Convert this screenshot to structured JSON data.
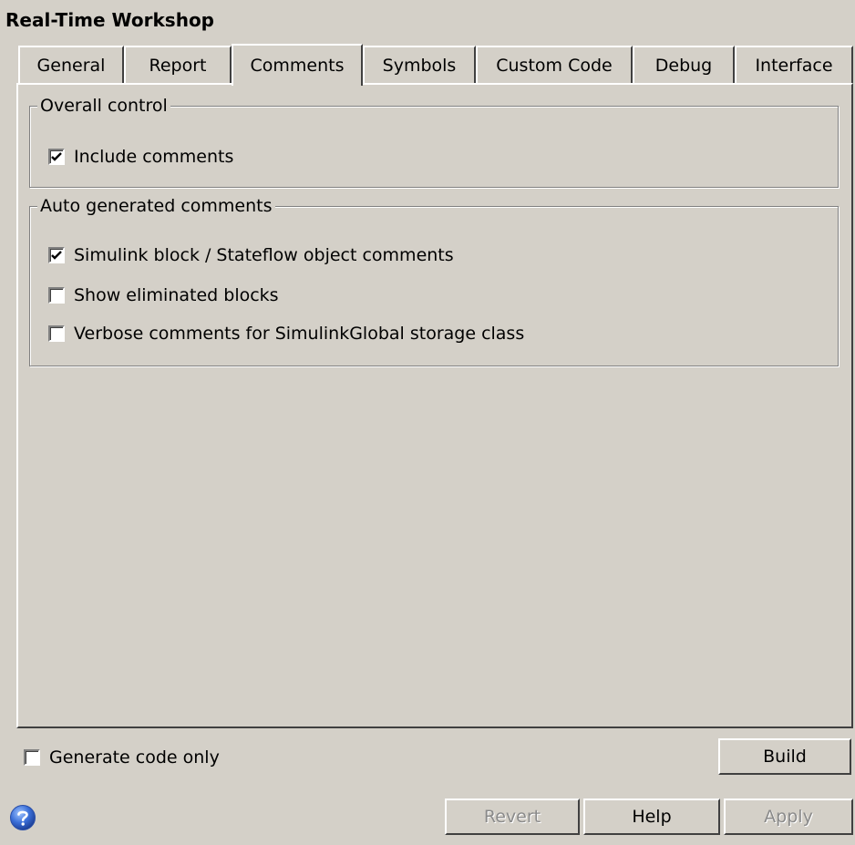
{
  "window": {
    "title": "Real-Time Workshop"
  },
  "tabs": [
    {
      "label": "General",
      "active": false
    },
    {
      "label": "Report",
      "active": false
    },
    {
      "label": "Comments",
      "active": true
    },
    {
      "label": "Symbols",
      "active": false
    },
    {
      "label": "Custom Code",
      "active": false
    },
    {
      "label": "Debug",
      "active": false
    },
    {
      "label": "Interface",
      "active": false
    }
  ],
  "overall_control": {
    "legend": "Overall control",
    "include_comments": {
      "label": "Include comments",
      "checked": true
    }
  },
  "auto_generated": {
    "legend": "Auto generated comments",
    "options": [
      {
        "label": "Simulink block / Stateflow object comments",
        "checked": true
      },
      {
        "label": "Show eliminated blocks",
        "checked": false
      },
      {
        "label": "Verbose comments for SimulinkGlobal storage class",
        "checked": false
      }
    ]
  },
  "footer": {
    "generate_code_only": {
      "label": "Generate code only",
      "checked": false
    },
    "build_label": "Build",
    "revert_label": "Revert",
    "help_label": "Help",
    "apply_label": "Apply",
    "help_icon": "question-circle-icon"
  }
}
